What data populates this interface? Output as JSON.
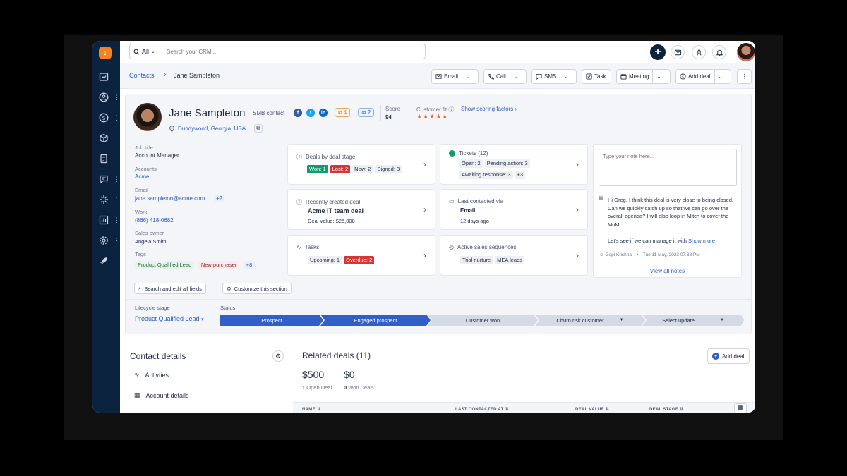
{
  "search": {
    "scope": "All",
    "placeholder": "Search your CRM..."
  },
  "breadcrumb": {
    "root": "Contacts",
    "current": "Jane Sampleton"
  },
  "actions": {
    "email": "Email",
    "call": "Call",
    "sms": "SMS",
    "task": "Task",
    "meeting": "Meeting",
    "add_deal": "Add deal"
  },
  "contact": {
    "name": "Jane Sampleton",
    "type": "SMB contact",
    "location": "Dundywood, Georgia, USA",
    "count_orange": "4",
    "count_blue": "2",
    "score_label": "Score",
    "score": "94",
    "fit_label": "Customer fit",
    "fit_stars": "★★★★★",
    "fit_link": "Show scoring factors"
  },
  "fields": {
    "job_title_label": "Job title",
    "job_title": "Account Manager",
    "accounts_label": "Accounts",
    "accounts": "Acme",
    "email_label": "Email",
    "email": "jane.sampleton@acme.com",
    "email_more": "+2",
    "work_label": "Work",
    "work": "(866) 418-0682",
    "owner_label": "Sales owner",
    "owner": "Angela Smith",
    "tags_label": "Tags",
    "tag1": "Product Qualified Lead",
    "tag2": "New purchaser",
    "tag_more": "+8"
  },
  "tiles": {
    "deals_stage": {
      "title": "Deals by deal stage",
      "won": "Won: 1",
      "lost": "Lost: 2",
      "new": "New: 2",
      "signed": "Signed: 3"
    },
    "tickets": {
      "title": "Tickets (12)",
      "open": "Open: 2",
      "pending": "Pending action: 3",
      "awaiting": "Awaiting response: 3",
      "more": "+3"
    },
    "recent_deal": {
      "title": "Recently created deal",
      "name": "Acme IT team deal",
      "value": "Deal value: $25,000"
    },
    "last_contact": {
      "title": "Last contacted via",
      "channel": "Email",
      "ago": "12 days ago"
    },
    "tasks": {
      "title": "Tasks",
      "upcoming": "Upcoming: 1",
      "overdue": "Overdue: 2"
    },
    "sequences": {
      "title": "Active sales sequences",
      "s1": "Trial nurture",
      "s2": "MEA leads"
    }
  },
  "notes": {
    "placeholder": "Type your note here...",
    "body": "Hi Greg, I think this deal is very close to being closed. Can we quickly catch up so that we can go over the overall agenda? I will also loop in Mitch to cover the MoM.",
    "body2": "Let's see if we can manage it with",
    "show_more": "Show more",
    "author": "Gopi Krishna",
    "date": "Tue 11 May, 2023 07:38 PM",
    "view_all": "View all notes"
  },
  "section_buttons": {
    "search_fields": "Search and edit all fields",
    "customize": "Customize this section"
  },
  "lifecycle": {
    "label": "Lifecycle stage",
    "value": "Product Qualified Lead",
    "status_label": "Status",
    "stages": [
      "Prospect",
      "Engaged prospect",
      "Customer won",
      "Churn risk customer",
      "Select update"
    ]
  },
  "contact_details": {
    "title": "Contact details",
    "items": [
      "Activties",
      "Account details"
    ]
  },
  "related_deals": {
    "title": "Related deals (11)",
    "add": "Add deal",
    "open_amount": "$500",
    "open_count": "1",
    "open_label": "Open Deal",
    "won_amount": "$0",
    "won_count": "0",
    "won_label": "Won Deals",
    "columns": [
      "NAME",
      "LAST CONTACTED AT",
      "DEAL VALUE",
      "DEAL STAGE"
    ]
  },
  "colors": {
    "nav": "#0c2340",
    "accent": "#2c5cc5",
    "stage_active": "#2f5fc7",
    "won": "#0f9d6b",
    "lost": "#d93434"
  }
}
